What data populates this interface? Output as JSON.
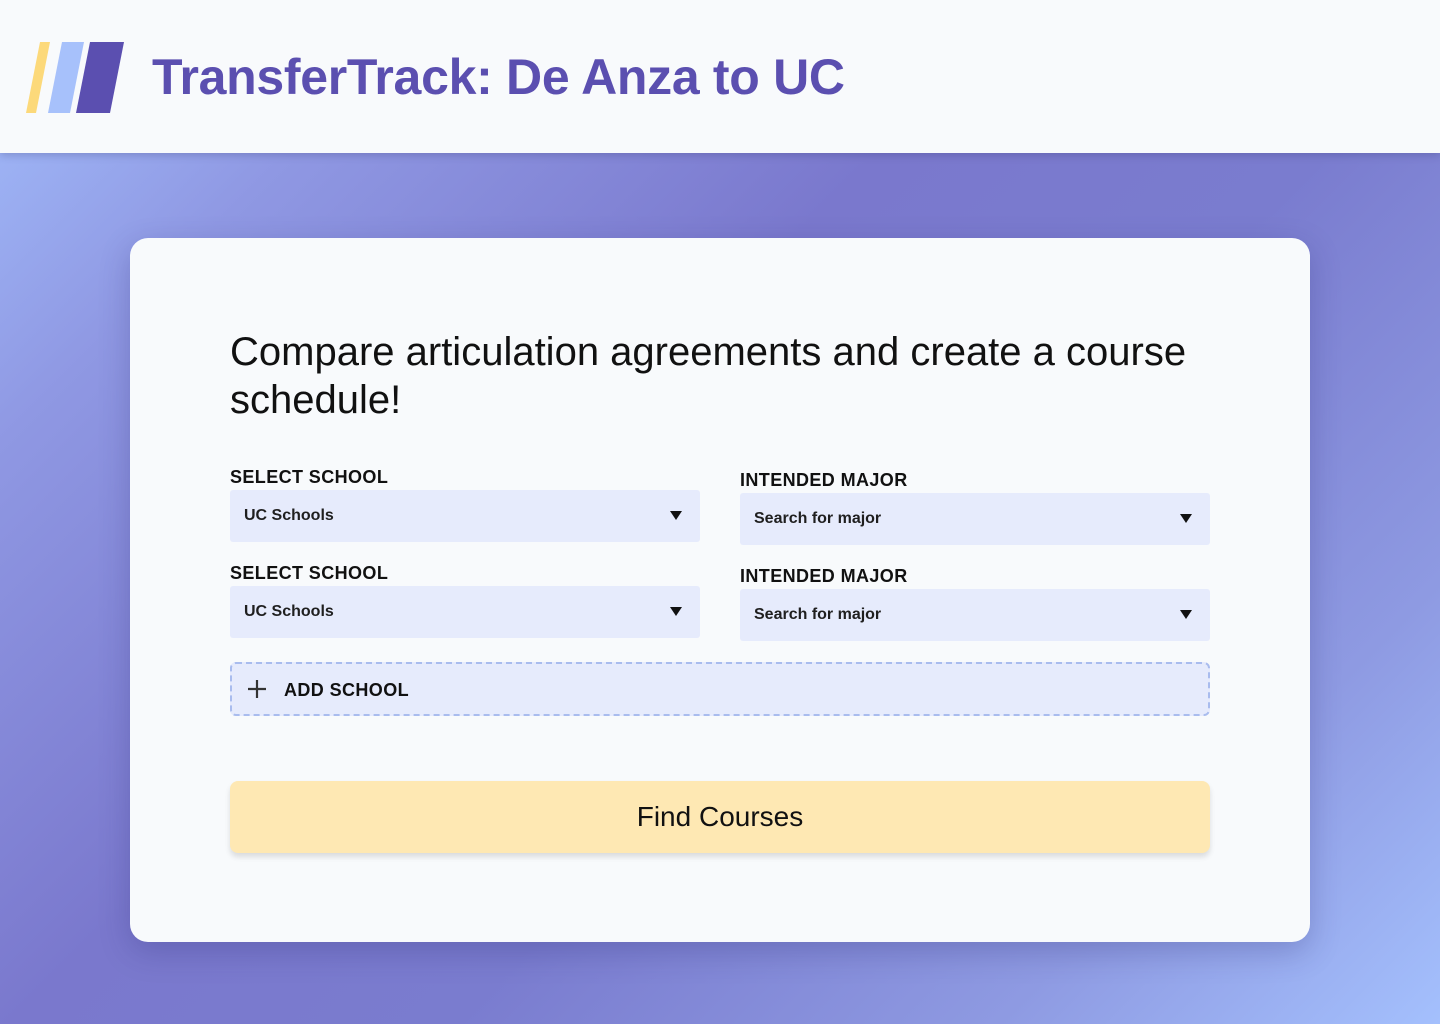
{
  "header": {
    "title": "TransferTrack: De Anza to UC",
    "logo_icon": "striped-parallelogram-logo-icon",
    "logo_colors": [
      "#fcd97a",
      "#a7c1fb",
      "#5b4fb0"
    ],
    "title_color": "#5b4fb0"
  },
  "main": {
    "headline": "Compare articulation agreements and create a course schedule!",
    "rows": [
      {
        "school_label": "SELECT SCHOOL",
        "school_value": "UC Schools",
        "major_label": "INTENDED MAJOR",
        "major_value": "Search for major"
      },
      {
        "school_label": "SELECT SCHOOL",
        "school_value": "UC Schools",
        "major_label": "INTENDED MAJOR",
        "major_value": "Search for major"
      }
    ],
    "dropdown_icon": "caret-down-icon",
    "add_school": {
      "icon": "plus-icon",
      "label": "ADD SCHOOL"
    },
    "find_button": {
      "label": "Find Courses",
      "color": "#fee8b3"
    }
  }
}
